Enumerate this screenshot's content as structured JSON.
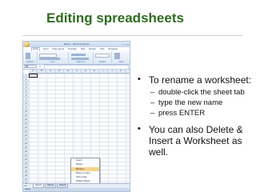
{
  "slide": {
    "title": "Editing spreadsheets",
    "bullets": [
      {
        "text": "To rename a worksheet:",
        "sub": [
          "double-click the sheet tab",
          "type the new name",
          "press ENTER"
        ]
      },
      {
        "text_lines": [
          "You can also Delete &",
          "Insert a Worksheet as",
          "well."
        ]
      }
    ]
  },
  "excel": {
    "window_title": "Book1 - Microsoft Excel",
    "ribbon_tabs": [
      "Home",
      "Insert",
      "Page Layout",
      "Formulas",
      "Data",
      "Review",
      "View",
      "Developer"
    ],
    "ribbon_groups": [
      "Clipboard",
      "Font",
      "Alignment",
      "Number",
      "Styles"
    ],
    "name_box": "B5",
    "fx_label": "fx",
    "columns": [
      "A",
      "B",
      "C",
      "D",
      "E",
      "F",
      "G",
      "H",
      "I",
      "J",
      "K"
    ],
    "rows": [
      "1",
      "2",
      "3",
      "4",
      "5",
      "6",
      "7",
      "8",
      "9",
      "10",
      "11",
      "12",
      "13",
      "14",
      "15",
      "16",
      "17",
      "18",
      "19",
      "20",
      "21",
      "22",
      "23",
      "24",
      "25",
      "26",
      "27",
      "28"
    ],
    "context_menu": [
      "Insert...",
      "Delete",
      "Rename",
      "Move or Copy...",
      "View Code",
      "Protect Sheet...",
      "Tab Color",
      "Hide",
      "Unhide...",
      "Select All Sheets"
    ],
    "context_highlight": "Rename",
    "sheet_tabs": [
      "Sheet1",
      "Sheet2",
      "Sheet3"
    ],
    "sheet_nav": "◂ ▸",
    "status_text": "Ready",
    "window_buttons": "– ▫ ×",
    "accent": "#2e6b1f"
  }
}
